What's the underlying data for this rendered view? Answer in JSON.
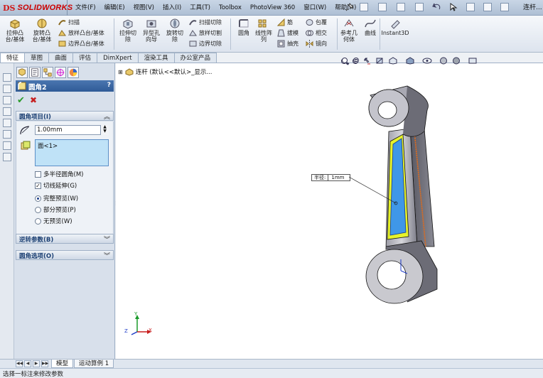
{
  "app": {
    "brand_ds": "DS",
    "brand_name": "SOLIDWORKS",
    "doc_title": "连杆..."
  },
  "menu": [
    "文件(F)",
    "编辑(E)",
    "视图(V)",
    "插入(I)",
    "工具(T)",
    "Toolbox",
    "PhotoView 360",
    "窗口(W)",
    "帮助(H)"
  ],
  "toolbar": {
    "extrude_boss": "拉伸凸\n台/基体",
    "revolve_boss": "旋转凸\n台/基体",
    "sweep": "扫描",
    "loft_boss": "放样凸台/基体",
    "boundary_boss": "边界凸台/基体",
    "extrude_cut": "拉伸切\n除",
    "hole_wizard": "异型孔\n向导",
    "revolve_cut": "旋转切\n除",
    "swept_cut": "扫描切除",
    "loft_cut": "放样切割",
    "boundary_cut": "边界切除",
    "fillet": "圆角",
    "linear_pattern": "线性阵\n列",
    "rib": "筋",
    "draft": "拔模",
    "shell": "抽壳",
    "wrap": "包覆",
    "intersect": "相交",
    "mirror": "镜向",
    "ref_geometry": "参考几\n何体",
    "curves": "曲线",
    "instant3d": "Instant3D"
  },
  "command_tabs": [
    "特征",
    "草图",
    "曲面",
    "评估",
    "DimXpert",
    "渲染工具",
    "办公室产品"
  ],
  "feature_tree": {
    "root_label": "连杆  (默认<<默认>_显示..."
  },
  "property_manager": {
    "title": "圆角2",
    "help": "?",
    "ok_symbol": "✔",
    "cancel_symbol": "✖",
    "group_items": {
      "title": "圆角项目(I)",
      "radius_value": "1.00mm",
      "selection": "面<1>",
      "multi_radius_label": "多半径圆角(M)",
      "multi_radius_checked": false,
      "tangent_propagation_label": "切线延伸(G)",
      "tangent_propagation_checked": true,
      "preview_options": [
        {
          "label": "完整预览(W)",
          "selected": true
        },
        {
          "label": "部分预览(P)",
          "selected": false
        },
        {
          "label": "无预览(W)",
          "selected": false
        }
      ]
    },
    "group_setback": {
      "title": "逆转参数(B)"
    },
    "group_options": {
      "title": "圆角选项(O)"
    }
  },
  "callout": {
    "key": "半径:",
    "value": "1mm"
  },
  "triad": {
    "x": "X",
    "y": "Y",
    "z": "Z"
  },
  "bottom_tabs": [
    "模型",
    "运动算例 1"
  ],
  "status": "选择一标注来修改参数",
  "colors": {
    "header_blue": "#2f5b97",
    "selection_blue": "#bfe2f7",
    "part_gray": "#c9c9cf",
    "fillet_face_blue": "#3f97e8",
    "highlight_yellow": "#e6f22a",
    "edge_orange": "#e36a18"
  }
}
